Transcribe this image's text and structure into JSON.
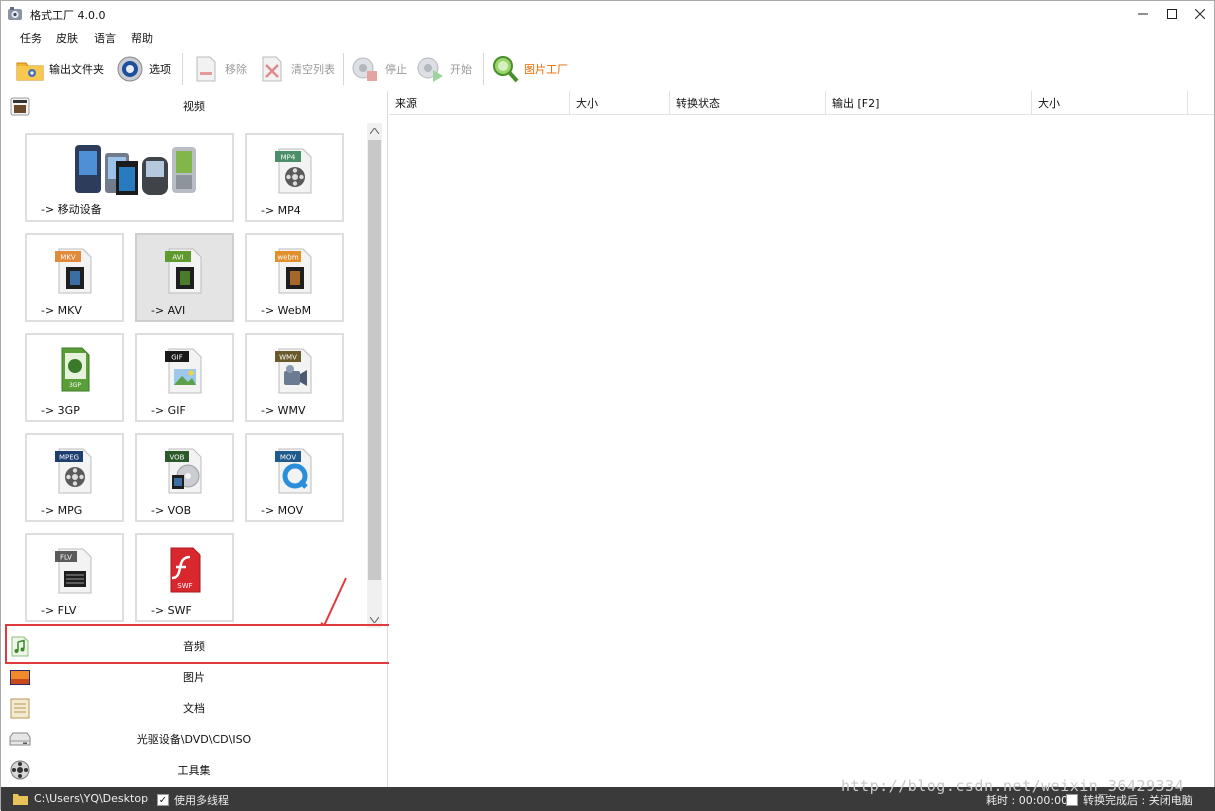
{
  "window": {
    "title": "格式工厂 4.0.0",
    "controls": {
      "minimize": "—",
      "maximize": "☐",
      "close": "✕"
    }
  },
  "menu": [
    "任务",
    "皮肤",
    "语言",
    "帮助"
  ],
  "toolbar": {
    "output_folder": "输出文件夹",
    "options": "选项",
    "remove": "移除",
    "clear_list": "清空列表",
    "stop": "停止",
    "start": "开始",
    "picture_factory": "图片工厂"
  },
  "left": {
    "video_header": "视频",
    "tiles": [
      {
        "label": "-> 移动设备",
        "icon": "mobile-devices-icon",
        "badge": ""
      },
      {
        "label": "-> MP4",
        "icon": "mp4-file-icon",
        "badge": "MP4"
      },
      {
        "label": "-> MKV",
        "icon": "mkv-file-icon",
        "badge": "MKV"
      },
      {
        "label": "-> AVI",
        "icon": "avi-file-icon",
        "badge": "AVI"
      },
      {
        "label": "-> WebM",
        "icon": "webm-file-icon",
        "badge": "webm"
      },
      {
        "label": "-> 3GP",
        "icon": "3gp-file-icon",
        "badge": "3GP"
      },
      {
        "label": "-> GIF",
        "icon": "gif-file-icon",
        "badge": "GIF"
      },
      {
        "label": "-> WMV",
        "icon": "wmv-file-icon",
        "badge": "WMV"
      },
      {
        "label": "-> MPG",
        "icon": "mpg-file-icon",
        "badge": "MPEG"
      },
      {
        "label": "-> VOB",
        "icon": "vob-file-icon",
        "badge": "VOB"
      },
      {
        "label": "-> MOV",
        "icon": "mov-file-icon",
        "badge": "MOV"
      },
      {
        "label": "-> FLV",
        "icon": "flv-file-icon",
        "badge": "FLV"
      },
      {
        "label": "-> SWF",
        "icon": "swf-file-icon",
        "badge": "SWF"
      }
    ],
    "selected_tile": "-> AVI",
    "categories": {
      "audio": "音频",
      "image": "图片",
      "document": "文档",
      "disc": "光驱设备\\DVD\\CD\\ISO",
      "tools": "工具集"
    }
  },
  "list": {
    "columns": [
      "来源",
      "大小",
      "转换状态",
      "输出 [F2]",
      "大小"
    ],
    "rows": []
  },
  "status": {
    "path": "C:\\Users\\YQ\\Desktop",
    "multithread": "使用多线程",
    "multithread_checked": true,
    "elapsed": "耗时 : 00:00:00",
    "shutdown": "转换完成后 : 关闭电脑",
    "shutdown_checked": false
  },
  "watermark": "http://blog.csdn.net/weixin_36429334",
  "colors": {
    "highlight": "#e03a3a",
    "status_bg": "#3a3a3a",
    "picture_factory_text": "#e86a00"
  }
}
